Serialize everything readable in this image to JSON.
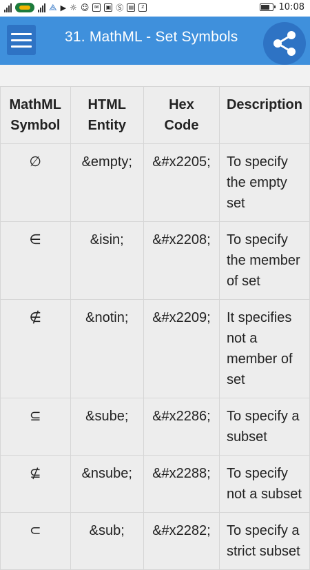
{
  "status_bar": {
    "time": "10:08"
  },
  "app_bar": {
    "title": "31. MathML - Set Symbols"
  },
  "table": {
    "headers": [
      "MathML Symbol",
      "HTML Entity",
      "Hex Code",
      "Description"
    ],
    "rows": [
      {
        "symbol": "∅",
        "entity": "&empty;",
        "hex": "&#x2205;",
        "description": "To specify the empty set"
      },
      {
        "symbol": "∈",
        "entity": "&isin;",
        "hex": "&#x2208;",
        "description": "To specify the member of set"
      },
      {
        "symbol": "∉",
        "entity": "&notin;",
        "hex": "&#x2209;",
        "description": "It specifies not a member of set"
      },
      {
        "symbol": "⊆",
        "entity": "&sube;",
        "hex": "&#x2286;",
        "description": "To specify a subset"
      },
      {
        "symbol": "⊈",
        "entity": "&nsube;",
        "hex": "&#x2288;",
        "description": "To specify not a subset"
      },
      {
        "symbol": "⊂",
        "entity": "&sub;",
        "hex": "&#x2282;",
        "description": "To specify a strict subset"
      }
    ]
  },
  "colors": {
    "app_bar": "#3f90dc",
    "menu_button": "#2e73c4",
    "table_bg": "#ededed"
  }
}
